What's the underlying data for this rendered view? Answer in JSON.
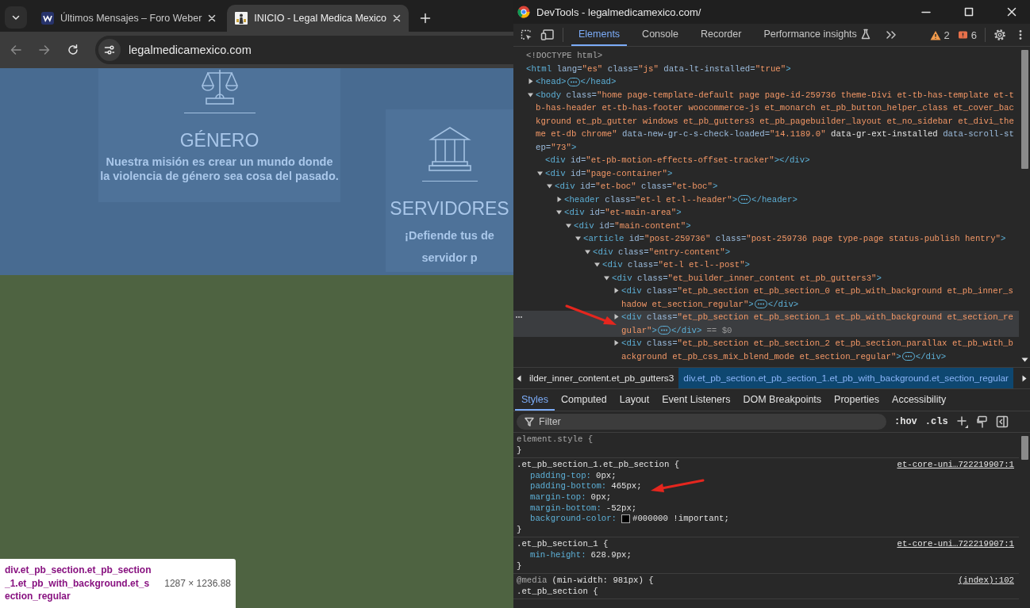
{
  "browser": {
    "tabs": [
      {
        "title": "Últimos Mensajes – Foro Weber",
        "selected": false
      },
      {
        "title": "INICIO - Legal Medica Mexico",
        "selected": true
      }
    ],
    "address": "legalmedicamexico.com",
    "page": {
      "cards": [
        {
          "title": "GÉNERO",
          "lines": [
            "Nuestra misión es crear un mundo donde",
            "la violencia de género sea cosa del pasado."
          ]
        },
        {
          "title": "SERVIDORES",
          "lines": [
            "¡Defiende tus de",
            "servidor p"
          ]
        }
      ]
    },
    "tooltip": {
      "selector": "div.et_pb_section.et_pb_section_1.et_pb_with_background.et_section_regular",
      "size": "1287 × 1236.88"
    }
  },
  "devtools": {
    "title": "DevTools - legalmedicamexico.com/",
    "tabs": [
      {
        "label": "Elements",
        "selected": true,
        "experimental": false
      },
      {
        "label": "Console",
        "selected": false,
        "experimental": false
      },
      {
        "label": "Recorder",
        "selected": false,
        "experimental": false
      },
      {
        "label": "Performance insights",
        "selected": false,
        "experimental": true
      }
    ],
    "warnings": "2",
    "errors": "6",
    "dom": [
      {
        "kind": "doctype",
        "text": "<!DOCTYPE html>",
        "selected": false
      },
      {
        "kind": "leaf",
        "text": "<html lang=\"es\" class=\"js\" data-lt-installed=\"true\">",
        "selected": false,
        "children": [
          {
            "kind": "element",
            "text": "<head>",
            "close": "</head>",
            "expanded": false,
            "selected": false
          },
          {
            "kind": "element",
            "text": "<body class=\"home page-template-default page page-id-259736 theme-Divi et-tb-has-template et-tb-has-header et-tb-has-footer woocommerce-js et_monarch et_pb_button_helper_class et_cover_background et_pb_gutter windows et_pb_gutters3 et_pb_pagebuilder_layout et_no_sidebar et_divi_theme et-db chrome\" data-new-gr-c-s-check-loaded=\"14.1189.0\" data-gr-ext-installed data-scroll-step=\"73\">",
            "expanded": true,
            "selected": false,
            "children": [
              {
                "kind": "leaf",
                "text": "<div id=\"et-pb-motion-effects-offset-tracker\"></div>",
                "selected": false
              },
              {
                "kind": "element",
                "text": "<div id=\"page-container\">",
                "expanded": true,
                "selected": false,
                "children": [
                  {
                    "kind": "element",
                    "text": "<div id=\"et-boc\" class=\"et-boc\">",
                    "expanded": true,
                    "selected": false,
                    "children": [
                      {
                        "kind": "element",
                        "text": "<header class=\"et-l et-l--header\">",
                        "close": "</header>",
                        "expanded": false,
                        "selected": false
                      },
                      {
                        "kind": "element",
                        "text": "<div id=\"et-main-area\">",
                        "expanded": true,
                        "selected": false,
                        "children": [
                          {
                            "kind": "element",
                            "text": "<div id=\"main-content\">",
                            "expanded": true,
                            "selected": false,
                            "children": [
                              {
                                "kind": "element",
                                "text": "<article id=\"post-259736\" class=\"post-259736 page type-page status-publish hentry\">",
                                "expanded": true,
                                "selected": false,
                                "children": [
                                  {
                                    "kind": "element",
                                    "text": "<div class=\"entry-content\">",
                                    "expanded": true,
                                    "selected": false,
                                    "children": [
                                      {
                                        "kind": "element",
                                        "text": "<div class=\"et-l et-l--post\">",
                                        "expanded": true,
                                        "selected": false,
                                        "children": [
                                          {
                                            "kind": "element",
                                            "text": "<div class=\"et_builder_inner_content et_pb_gutters3\">",
                                            "expanded": true,
                                            "selected": false,
                                            "children": [
                                              {
                                                "kind": "element",
                                                "text": "<div class=\"et_pb_section et_pb_section_0 et_pb_with_background et_pb_inner_shadow et_section_regular\">",
                                                "close": "</div>",
                                                "expanded": false,
                                                "selected": false
                                              },
                                              {
                                                "kind": "element",
                                                "text": "<div class=\"et_pb_section et_pb_section_1 et_pb_with_background et_section_regular\">",
                                                "close": "</div>",
                                                "suffix": "== $0",
                                                "expanded": false,
                                                "selected": true
                                              },
                                              {
                                                "kind": "element",
                                                "text": "<div class=\"et_pb_section et_pb_section_2 et_pb_section_parallax et_pb_with_background  et_pb_css_mix_blend_mode et_section_regular\">",
                                                "close": "</div>",
                                                "expanded": false,
                                                "selected": false
                                              }
                                            ]
                                          }
                                        ]
                                      }
                                    ]
                                  }
                                ]
                              }
                            ]
                          }
                        ]
                      }
                    ]
                  }
                ]
              }
            ]
          }
        ]
      }
    ],
    "breadcrumbs": [
      {
        "label": "ilder_inner_content.et_pb_gutters3",
        "selected": false
      },
      {
        "label": "div.et_pb_section.et_pb_section_1.et_pb_with_background.et_section_regular",
        "selected": true
      }
    ],
    "sidebar_tabs": [
      {
        "label": "Styles",
        "selected": true
      },
      {
        "label": "Computed",
        "selected": false
      },
      {
        "label": "Layout",
        "selected": false
      },
      {
        "label": "Event Listeners",
        "selected": false
      },
      {
        "label": "DOM Breakpoints",
        "selected": false
      },
      {
        "label": "Properties",
        "selected": false
      },
      {
        "label": "Accessibility",
        "selected": false
      }
    ],
    "filter": {
      "placeholder": "Filter"
    },
    "filter_buttons": [
      ":hov",
      ".cls"
    ],
    "rules": [
      {
        "kind": "inline",
        "selector": "element.style {",
        "close": "}"
      },
      {
        "kind": "rule",
        "selector": ".et_pb_section_1.et_pb_section {",
        "source": "et-core-uni…722219907:1",
        "close": "}",
        "props": [
          {
            "name": "padding-top:",
            "value": "0px;"
          },
          {
            "name": "padding-bottom:",
            "value": "465px;"
          },
          {
            "name": "margin-top:",
            "value": "0px;"
          },
          {
            "name": "margin-bottom:",
            "value": "-52px;"
          },
          {
            "name": "background-color:",
            "value": "#000000 !important;",
            "color": "#000000"
          }
        ]
      },
      {
        "kind": "rule",
        "selector": ".et_pb_section_1 {",
        "source": "et-core-uni…722219907:1",
        "close": "}",
        "props": [
          {
            "name": "min-height:",
            "value": "628.9px;"
          }
        ]
      },
      {
        "kind": "media",
        "at_rule": "@media",
        "query": "(min-width: 981px) {",
        "source": "(index):102",
        "selector": ".et_pb_section {"
      }
    ]
  }
}
